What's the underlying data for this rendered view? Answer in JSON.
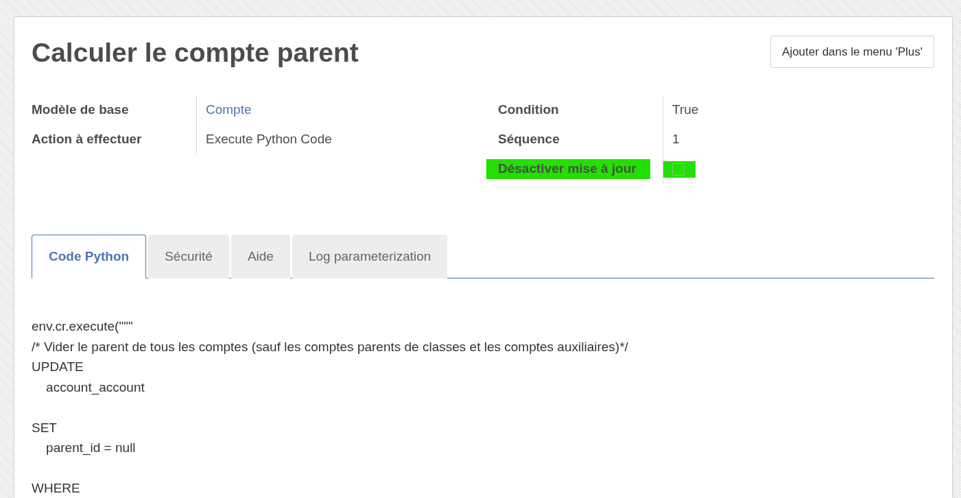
{
  "title": "Calculer le compte parent",
  "header_button": "Ajouter dans le menu 'Plus'",
  "left_fields": [
    {
      "label": "Modèle de base",
      "value": "Compte",
      "kind": "link"
    },
    {
      "label": "Action à effectuer",
      "value": "Execute Python Code",
      "kind": "text"
    }
  ],
  "right_fields": [
    {
      "label": "Condition",
      "value": "True",
      "kind": "text",
      "highlighted": false
    },
    {
      "label": "Séquence",
      "value": "1",
      "kind": "text",
      "highlighted": false
    },
    {
      "label": "Désactiver mise à jour",
      "kind": "checkbox",
      "checked": false,
      "highlighted": true
    }
  ],
  "tabs": [
    {
      "label": "Code Python",
      "selected": true
    },
    {
      "label": "Sécurité",
      "selected": false
    },
    {
      "label": "Aide",
      "selected": false
    },
    {
      "label": "Log parameterization",
      "selected": false
    }
  ],
  "code": "env.cr.execute(\"\"\"\n/* Vider le parent de tous les comptes (sauf les comptes parents de classes et les comptes auxiliaires)*/\nUPDATE\n    account_account\n\nSET\n    parent_id = null\n\nWHERE"
}
